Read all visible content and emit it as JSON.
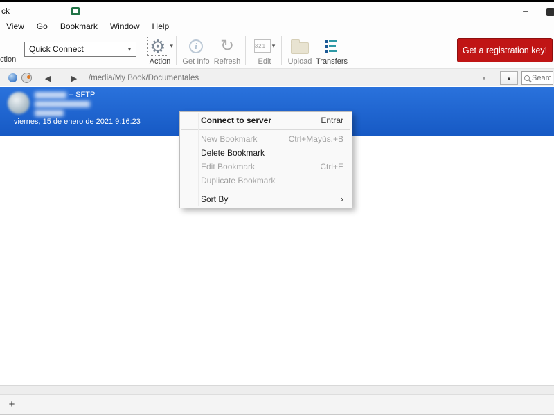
{
  "window": {
    "title_fragment": "ck",
    "minimize_glyph": "─"
  },
  "menu_bar": {
    "items": [
      {
        "label": "View"
      },
      {
        "label": "Go"
      },
      {
        "label": "Bookmark"
      },
      {
        "label": "Window"
      },
      {
        "label": "Help"
      }
    ]
  },
  "toolbar": {
    "clipped_button_label": "ction",
    "quick_connect_value": "Quick Connect",
    "buttons": [
      {
        "label": "Action"
      },
      {
        "label": "Get Info"
      },
      {
        "label": "Refresh"
      },
      {
        "label": "Edit"
      },
      {
        "label": "Upload"
      },
      {
        "label": "Transfers"
      }
    ],
    "registration_label": "Get a registration key!",
    "clapper_numbers": "321"
  },
  "navbar": {
    "path": "/media/My Book/Documentales",
    "search_placeholder": "Search…"
  },
  "bookmark_list": {
    "selected": {
      "protocol_suffix": "– SFTP",
      "timestamp": "viernes, 15 de enero de 2021 9:16:23"
    }
  },
  "context_menu": {
    "items": [
      {
        "label": "Connect to server",
        "shortcut": "Entrar"
      },
      {
        "type": "separator"
      },
      {
        "label": "New Bookmark",
        "shortcut": "Ctrl+Mayús.+B"
      },
      {
        "label": "Delete Bookmark",
        "shortcut": ""
      },
      {
        "label": "Edit Bookmark",
        "shortcut": "Ctrl+E"
      },
      {
        "label": "Duplicate Bookmark",
        "shortcut": ""
      },
      {
        "type": "separator"
      },
      {
        "label": "Sort By",
        "submenu_arrow": "›"
      }
    ]
  },
  "bottom_bar": {
    "add_button": "+"
  },
  "colors": {
    "selection_blue": "#1b65d2",
    "registration_red": "#c01515",
    "transfers_teal": "#2e9aa6"
  }
}
